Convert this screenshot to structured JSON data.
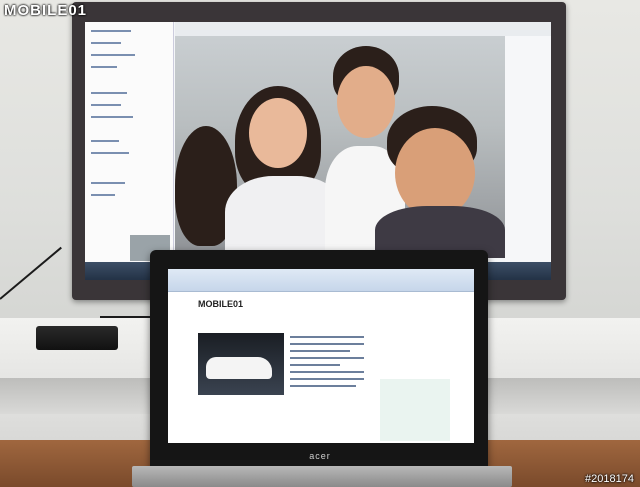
{
  "watermark": {
    "logo": "MOBILE01",
    "photo_id": "#2018174"
  },
  "laptop": {
    "brand": "acer",
    "page_logo": "MOBILE01"
  },
  "colors": {
    "tv_frame": "#3a3538",
    "laptop_frame": "#151515",
    "floor": "#8a5534"
  }
}
